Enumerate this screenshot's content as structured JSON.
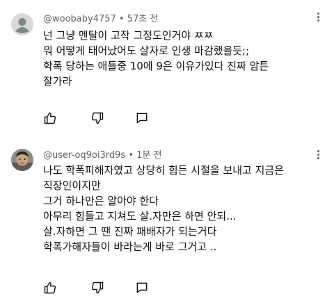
{
  "comments": [
    {
      "username": "@woobaby4757",
      "separator": "•",
      "timestamp": "57초 전",
      "lines": [
        "넌 그냥 멘탈이 고작 그정도인거야 ㅉㅉ",
        "뭐 어떻게 태어났어도 살자로 인생 마감했을듯;;",
        "학폭 당하는 애들중 10에 9은 이유가있다 진짜 암튼",
        "잘가라"
      ],
      "avatar_icon": "default-person-avatar",
      "avatar_color": "#d8d8d8"
    },
    {
      "username": "@user-oq9oi3rd9s",
      "separator": "•",
      "timestamp": "1분 전",
      "lines": [
        "나도 학폭피해자였고 상당히 힘든 시절을 보내고 지금은",
        "직장인이지만",
        "그거 하나만은 알아야 한다",
        "아무리 힘들고 지쳐도 살.자만은 하면 안되...",
        "살.자하면 그 땐 진짜 패배자가 되는거다",
        "학폭가해자들이 바라는게 바로 그거고 .."
      ],
      "avatar_icon": "photo-avatar"
    }
  ],
  "icons": {
    "like": "thumbs-up-icon",
    "dislike": "thumbs-down-icon",
    "reply": "reply-icon",
    "more": "more-vert-icon"
  }
}
